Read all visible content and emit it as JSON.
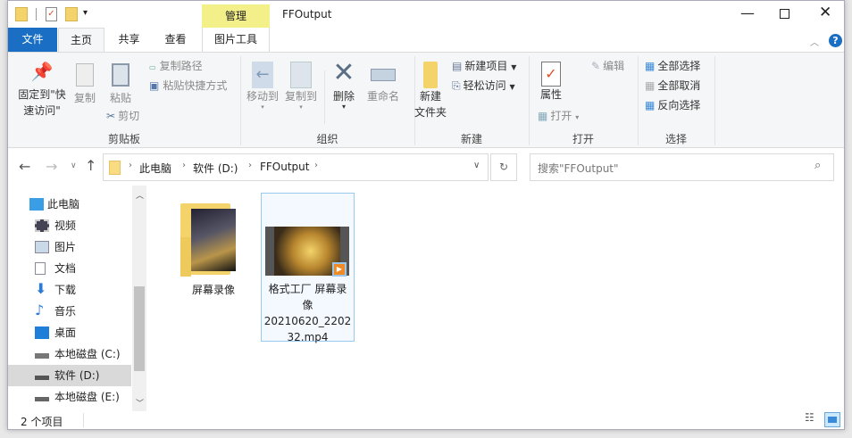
{
  "window": {
    "title": "FFOutput",
    "context_tab": "管理"
  },
  "ribbon_tabs": {
    "file": "文件",
    "home": "主页",
    "share": "共享",
    "view": "查看",
    "picture_tools": "图片工具"
  },
  "clipboard": {
    "pin_line1": "固定到\"快",
    "pin_line2": "速访问\"",
    "copy": "复制",
    "paste": "粘贴",
    "copy_path": "复制路径",
    "paste_shortcut": "粘贴快捷方式",
    "cut": "剪切",
    "label": "剪贴板"
  },
  "organize": {
    "move_to": "移动到",
    "copy_to": "复制到",
    "delete": "删除",
    "rename": "重命名",
    "label": "组织"
  },
  "new": {
    "new_folder_line1": "新建",
    "new_folder_line2": "文件夹",
    "new_item": "新建项目",
    "easy_access": "轻松访问",
    "label": "新建"
  },
  "open": {
    "properties": "属性",
    "open": "打开",
    "edit": "编辑",
    "label": "打开"
  },
  "select": {
    "select_all": "全部选择",
    "select_none": "全部取消",
    "invert": "反向选择",
    "label": "选择"
  },
  "address": {
    "crumbs": [
      "此电脑",
      "软件 (D:)",
      "FFOutput"
    ]
  },
  "search": {
    "placeholder": "搜索\"FFOutput\""
  },
  "nav": [
    {
      "label": "此电脑"
    },
    {
      "label": "视频"
    },
    {
      "label": "图片"
    },
    {
      "label": "文档"
    },
    {
      "label": "下载"
    },
    {
      "label": "音乐"
    },
    {
      "label": "桌面"
    },
    {
      "label": "本地磁盘 (C:)"
    },
    {
      "label": "软件 (D:)"
    },
    {
      "label": "本地磁盘 (E:)"
    }
  ],
  "files": [
    {
      "name": "屏幕录像"
    },
    {
      "name_line1": "格式工厂 屏幕录",
      "name_line2": "像",
      "name_line3": "20210620_2202",
      "name_line4": "32.mp4"
    }
  ],
  "status": {
    "count": "2 个项目"
  },
  "colors": {
    "file_tab": "#1a6fc4",
    "context_tab": "#f3f08a",
    "selection": "#cce8ff",
    "nav_selected": "#d9d9d9"
  }
}
